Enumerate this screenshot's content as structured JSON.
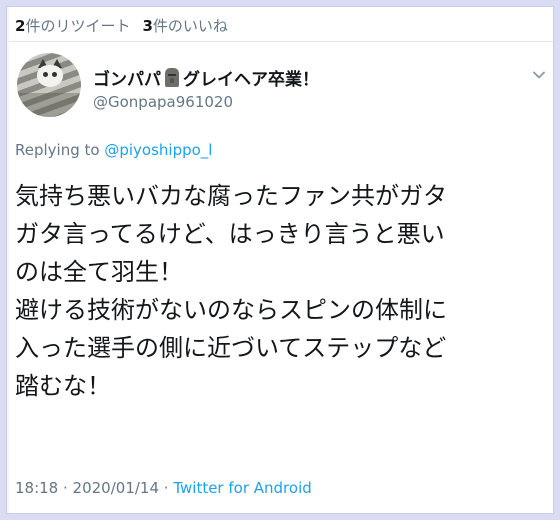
{
  "stats": {
    "retweet_count": "2",
    "retweet_label": "件のリツイート",
    "like_count": "3",
    "like_label": "件のいいね"
  },
  "author": {
    "name_part1": "ゴンパパ",
    "name_emoji_icon": "moai-icon",
    "name_part2": "グレイヘア卒業！",
    "handle": "@Gonpapa961020"
  },
  "reply": {
    "prefix": "Replying to ",
    "to_handle": "@piyoshippo_l"
  },
  "tweet": {
    "lines": [
      "気持ち悪いバカな腐ったファン共がガタ",
      "ガタ言ってるけど、はっきり言うと悪い",
      "のは全て羽生！",
      "避ける技術がないのならスピンの体制に",
      "入った選手の側に近づいてステップなど",
      "踏むな！"
    ]
  },
  "meta": {
    "time": "18:18",
    "sep1": " · ",
    "date": "2020/01/14",
    "sep2": " · ",
    "source": "Twitter for Android"
  },
  "colors": {
    "link": "#1da1f2",
    "secondary_text": "#657786",
    "primary_text": "#14171a",
    "page_background": "#d9dcf2"
  }
}
